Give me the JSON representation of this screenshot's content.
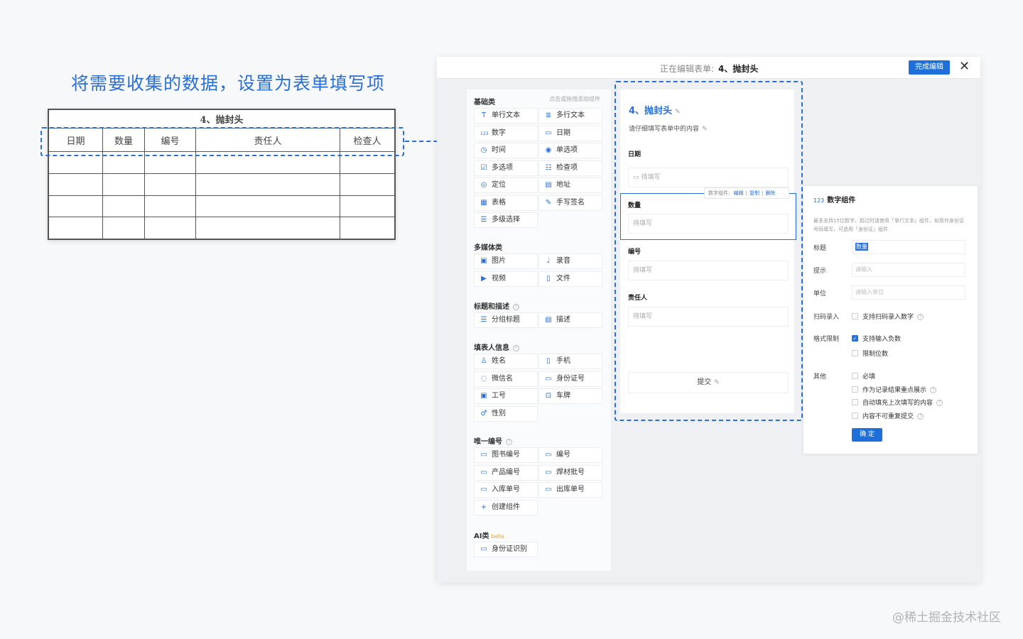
{
  "headline": "将需要收集的数据，设置为表单填写项",
  "paper_table": {
    "title": "4、抛封头",
    "headers": [
      "日期",
      "数量",
      "编号",
      "责任人",
      "检查人"
    ],
    "empty_rows": 4
  },
  "topbar": {
    "editing_label": "正在编辑表单:",
    "form_name": "4、抛封头",
    "done_button": "完成编辑",
    "close": "✕"
  },
  "palette": {
    "hint": "点击或拖拽添加组件",
    "sections": [
      {
        "title": "基础类",
        "items": [
          {
            "icon": "T",
            "label": "单行文本"
          },
          {
            "icon": "≣",
            "label": "多行文本"
          },
          {
            "icon": "123",
            "label": "数字"
          },
          {
            "icon": "▭",
            "label": "日期"
          },
          {
            "icon": "◷",
            "label": "时间"
          },
          {
            "icon": "◉",
            "label": "单选项"
          },
          {
            "icon": "☑",
            "label": "多选项"
          },
          {
            "icon": "☷",
            "label": "检查项"
          },
          {
            "icon": "◎",
            "label": "定位"
          },
          {
            "icon": "▤",
            "label": "地址"
          },
          {
            "icon": "▦",
            "label": "表格"
          },
          {
            "icon": "✎",
            "label": "手写签名"
          },
          {
            "icon": "☰",
            "label": "多级选择"
          }
        ]
      },
      {
        "title": "多媒体类",
        "items": [
          {
            "icon": "▣",
            "label": "图片"
          },
          {
            "icon": "♩",
            "label": "录音"
          },
          {
            "icon": "▶",
            "label": "视频"
          },
          {
            "icon": "▯",
            "label": "文件"
          }
        ]
      },
      {
        "title": "标题和描述",
        "items": [
          {
            "icon": "☰",
            "label": "分组标题"
          },
          {
            "icon": "▤",
            "label": "描述"
          }
        ]
      },
      {
        "title": "填表人信息",
        "items": [
          {
            "icon": "♙",
            "label": "姓名"
          },
          {
            "icon": "▯",
            "label": "手机"
          },
          {
            "icon": "◌",
            "label": "微信名"
          },
          {
            "icon": "▭",
            "label": "身份证号"
          },
          {
            "icon": "▣",
            "label": "工号"
          },
          {
            "icon": "⊡",
            "label": "车牌"
          },
          {
            "icon": "♂",
            "label": "性别"
          }
        ]
      },
      {
        "title": "唯一编号",
        "items": [
          {
            "icon": "▭",
            "label": "图书编号"
          },
          {
            "icon": "▭",
            "label": "编号"
          },
          {
            "icon": "▭",
            "label": "产品编号"
          },
          {
            "icon": "▭",
            "label": "焊材批号"
          },
          {
            "icon": "▭",
            "label": "入库单号"
          },
          {
            "icon": "▭",
            "label": "出库单号"
          },
          {
            "icon": "+",
            "label": "创建组件"
          }
        ]
      },
      {
        "title": "AI类",
        "badge": "beta",
        "items": [
          {
            "icon": "▭",
            "label": "身份证识别"
          }
        ]
      }
    ]
  },
  "canvas": {
    "form_title": "4、抛封头",
    "description": "请仔细填写表单中的内容",
    "fields": [
      {
        "label": "日期",
        "placeholder": "待填写",
        "icon": "▭"
      },
      {
        "label": "数量",
        "placeholder": "待填写"
      },
      {
        "label": "编号",
        "placeholder": "待填写"
      },
      {
        "label": "责任人",
        "placeholder": "待填写"
      }
    ],
    "toolbar": {
      "prefix": "数字组件:",
      "edit": "编辑",
      "copy": "复制",
      "delete": "删除"
    },
    "submit": "提交"
  },
  "props": {
    "title": "数字组件",
    "description": "最多支持15位数字，超过时请使用「单行文本」组件，如用作身份证号码填写，可选用「身份证」组件",
    "title_label": "标题",
    "title_value": "数量",
    "hint_label": "提示",
    "hint_placeholder": "请输入",
    "unit_label": "单位",
    "unit_placeholder": "请输入单位",
    "scan_label": "扫码录入",
    "scan_option": "支持扫码录入数字",
    "format_label": "格式限制",
    "format_options": [
      {
        "label": "支持输入负数",
        "checked": true
      },
      {
        "label": "限制位数",
        "checked": false
      }
    ],
    "other_label": "其他",
    "other_options": [
      {
        "label": "必填",
        "checked": false,
        "help": false
      },
      {
        "label": "作为记录结果重点展示",
        "checked": false,
        "help": true
      },
      {
        "label": "自动填充上次填写的内容",
        "checked": false,
        "help": true
      },
      {
        "label": "内容不可重复提交",
        "checked": false,
        "help": true
      }
    ],
    "confirm": "确 定"
  },
  "watermark": "@稀土掘金技术社区",
  "colors": {
    "accent": "#2a6fd6",
    "button": "#1e6fd9"
  }
}
